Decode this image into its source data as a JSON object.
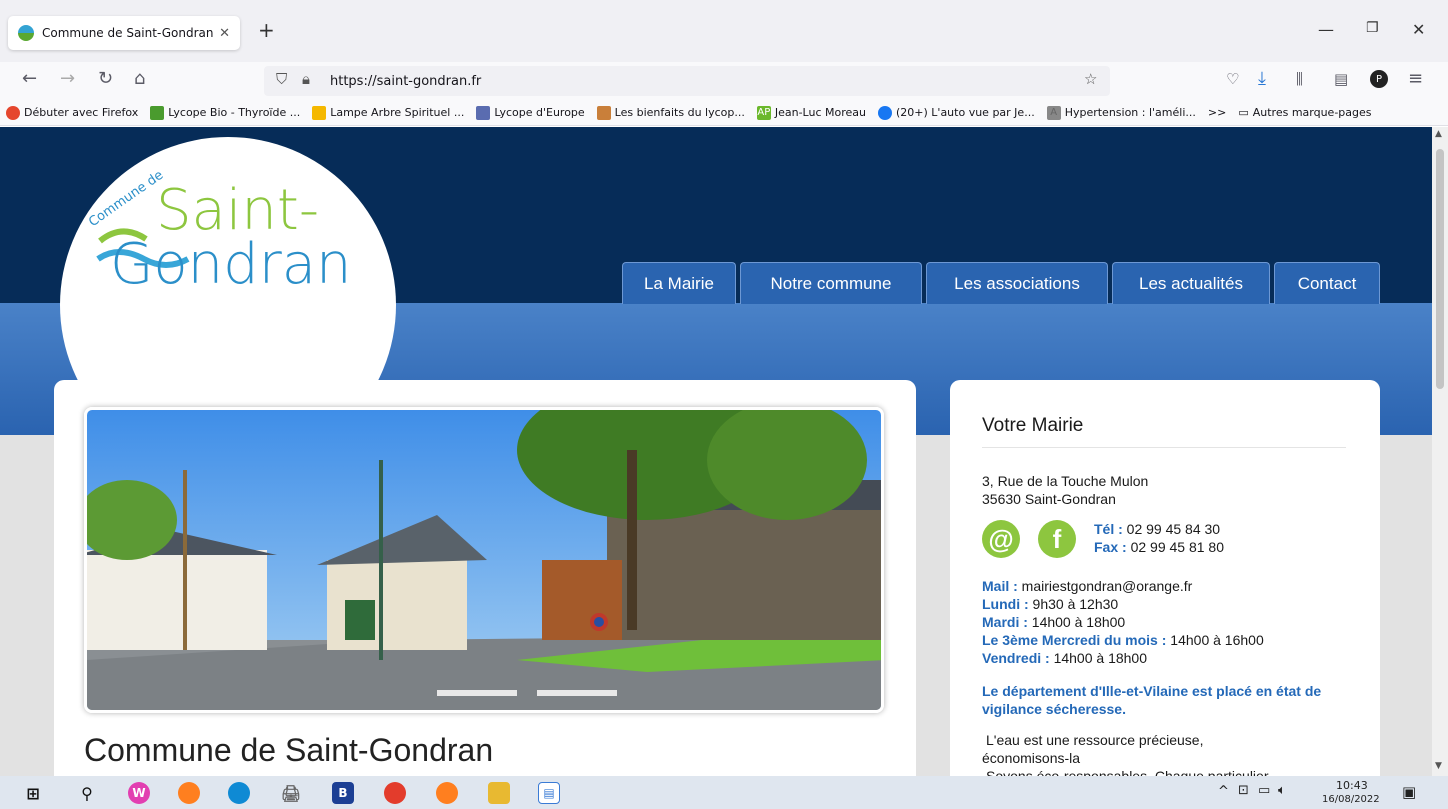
{
  "browser": {
    "tab_title": "Commune de Saint-Gondran",
    "url": "https://saint-gondran.fr",
    "bookmarks": [
      {
        "label": "Débuter avec Firefox",
        "color": "#e5462d"
      },
      {
        "label": "Lycope Bio - Thyroïde ...",
        "color": "#4a9b2e"
      },
      {
        "label": "Lampe Arbre Spirituel ...",
        "color": "#f5b800"
      },
      {
        "label": "Lycope d'Europe",
        "color": "#5a6cb0"
      },
      {
        "label": "Les bienfaits du lycop...",
        "color": "#c97f3a"
      },
      {
        "label": "Jean-Luc Moreau",
        "color": "#6bb82b",
        "badge": "AP"
      },
      {
        "label": "(20+) L'auto vue par Je...",
        "color": "#1877f2"
      },
      {
        "label": "Hypertension : l'améli...",
        "color": "#888888",
        "badge": "A"
      }
    ],
    "bookmarks_more": ">>",
    "other_bookmarks": "Autres marque-pages"
  },
  "site": {
    "logo": {
      "small": "Commune de",
      "line1": "Saint-",
      "line2": "Gondran"
    },
    "nav": [
      "La Mairie",
      "Notre commune",
      "Les associations",
      "Les actualités",
      "Contact"
    ],
    "main_title": "Commune de Saint-Gondran",
    "sidebar": {
      "title": "Votre Mairie",
      "address1": "3, Rue de la Touche Mulon",
      "address2": "35630 Saint-Gondran",
      "tel_label": "Tél :",
      "tel": "02 99 45 84 30",
      "fax_label": "Fax :",
      "fax": "02 99 45 81 80",
      "mail_label": "Mail :",
      "mail": "mairiestgondran@orange.fr",
      "hours": [
        {
          "day": "Lundi :",
          "time": "9h30 à 12h30"
        },
        {
          "day": "Mardi :",
          "time": "14h00 à 18h00"
        },
        {
          "day": "Le 3ème Mercredi du mois :",
          "time": "14h00 à 16h00"
        },
        {
          "day": "Vendredi :",
          "time": "14h00 à 18h00"
        }
      ],
      "alert": "Le département d'Ille-et-Vilaine est placé en état de vigilance sécheresse.",
      "text1": "L'eau est une ressource précieuse,",
      "text2": "économisons-la",
      "text3": "Soyons éco-responsables. Chaque particulier"
    }
  },
  "taskbar": {
    "time": "10:43",
    "date": "16/08/2022"
  }
}
